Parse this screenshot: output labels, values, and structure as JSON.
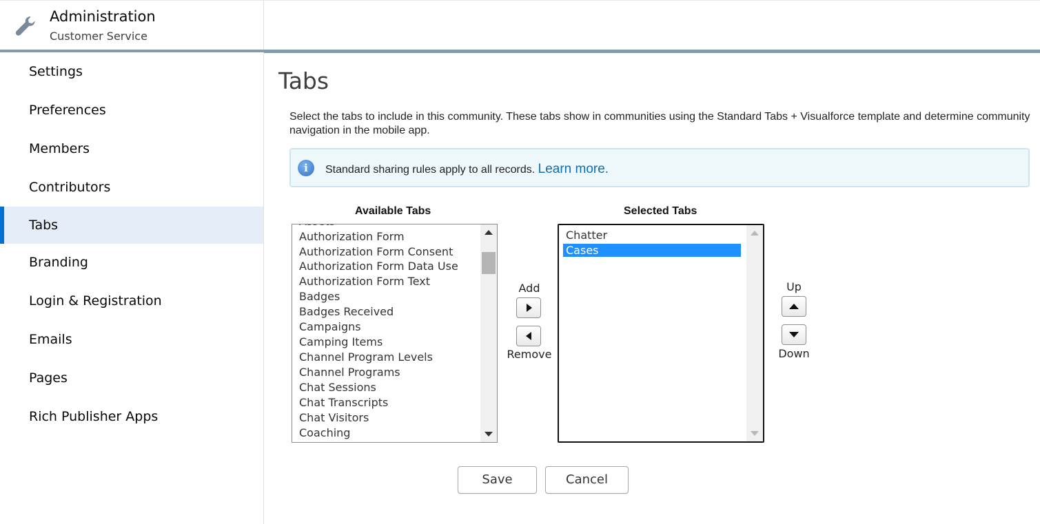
{
  "header": {
    "title": "Administration",
    "subtitle": "Customer Service",
    "icon": "wrench-icon"
  },
  "sidebar": {
    "items": [
      {
        "label": "Settings"
      },
      {
        "label": "Preferences"
      },
      {
        "label": "Members"
      },
      {
        "label": "Contributors"
      },
      {
        "label": "Tabs",
        "active": true
      },
      {
        "label": "Branding"
      },
      {
        "label": "Login & Registration"
      },
      {
        "label": "Emails"
      },
      {
        "label": "Pages"
      },
      {
        "label": "Rich Publisher Apps"
      }
    ]
  },
  "main": {
    "title": "Tabs",
    "description": "Select the tabs to include in this community. These tabs show in communities using the Standard Tabs + Visualforce template and determine community navigation in the mobile app.",
    "info": {
      "text": "Standard sharing rules apply to all records.",
      "link": "Learn more."
    },
    "available": {
      "heading": "Available Tabs",
      "options": [
        "Authorization Form",
        "Authorization Form Consent",
        "Authorization Form Data Use",
        "Authorization Form Text",
        "Badges",
        "Badges Received",
        "Campaigns",
        "Camping Items",
        "Channel Program Levels",
        "Channel Programs",
        "Chat Sessions",
        "Chat Transcripts",
        "Chat Visitors",
        "Coaching"
      ]
    },
    "selected": {
      "heading": "Selected Tabs",
      "options": [
        "Chatter",
        "Cases"
      ],
      "selected_option": "Cases"
    },
    "add_label": "Add",
    "remove_label": "Remove",
    "up_label": "Up",
    "down_label": "Down",
    "save_label": "Save",
    "cancel_label": "Cancel"
  },
  "colors": {
    "accent": "#0070d2",
    "active_nav_bg": "#e5eef8",
    "header_bar": "#849ba8",
    "selected_option": "#1e90ff",
    "link": "#0a6fb5"
  }
}
